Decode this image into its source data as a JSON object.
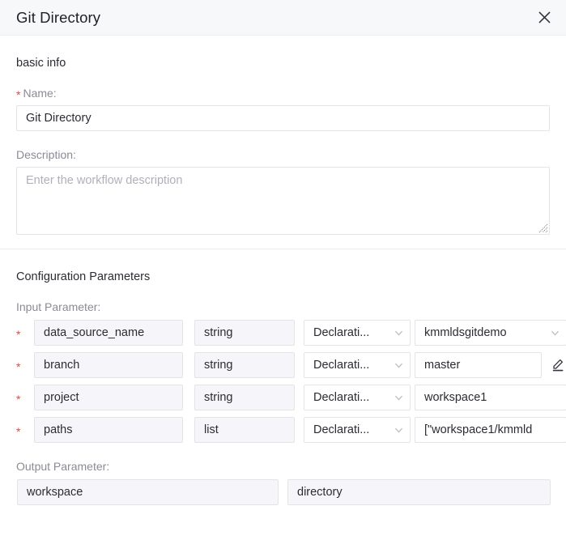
{
  "header": {
    "title": "Git Directory",
    "close_icon": "close-icon"
  },
  "basic_info": {
    "section_title": "basic info",
    "name_label": "Name:",
    "name_value": "Git Directory",
    "description_label": "Description:",
    "description_value": "",
    "description_placeholder": "Enter the workflow description",
    "required_marker": "*"
  },
  "configuration": {
    "section_title": "Configuration Parameters",
    "input_label": "Input Parameter:",
    "output_label": "Output Parameter:",
    "input_parameters": [
      {
        "required": "*",
        "name": "data_source_name",
        "type": "string",
        "kind": "Declarati...",
        "value": "kmmldsgitdemo",
        "value_control": "select",
        "has_edit_icon": false
      },
      {
        "required": "*",
        "name": "branch",
        "type": "string",
        "kind": "Declarati...",
        "value": "master",
        "value_control": "input",
        "has_edit_icon": true
      },
      {
        "required": "*",
        "name": "project",
        "type": "string",
        "kind": "Declarati...",
        "value": "workspace1",
        "value_control": "input",
        "has_edit_icon": false
      },
      {
        "required": "*",
        "name": "paths",
        "type": "list",
        "kind": "Declarati...",
        "value": "[\"workspace1/kmmld",
        "value_control": "input",
        "has_edit_icon": false
      }
    ],
    "output_parameters": [
      {
        "name": "workspace",
        "type": "directory"
      }
    ]
  },
  "icons": {
    "close": "close-icon",
    "chevron_down": "chevron-down-icon",
    "edit": "pencil-edit-icon",
    "resize": "resize-grip-icon"
  },
  "colors": {
    "required_red": "#e8453c",
    "header_bg": "#f7f8fa",
    "border": "#e4e4e8",
    "readonly_bg": "#f6f6fa",
    "label_grey": "#8b8b96",
    "text_dark": "#2b2b33"
  }
}
